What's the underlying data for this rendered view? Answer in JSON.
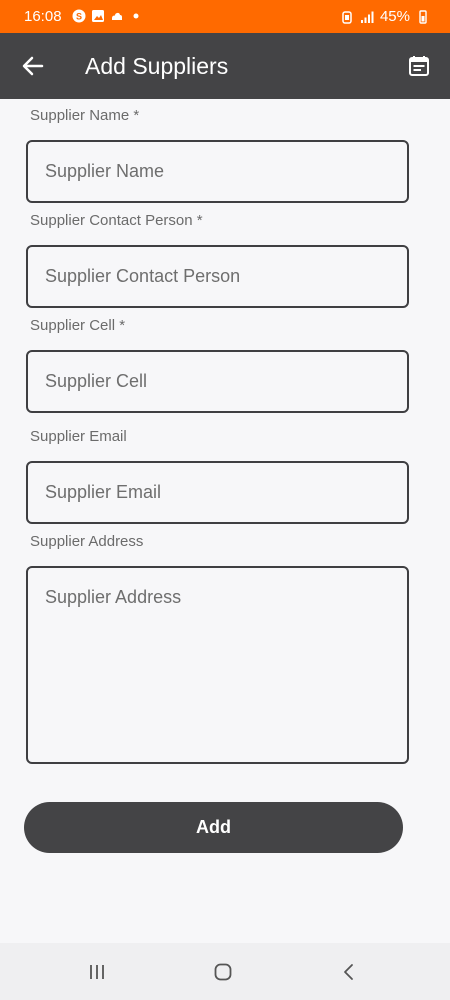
{
  "status_bar": {
    "time": "16:08",
    "battery": "45%",
    "left_icons": [
      "s-badge-icon",
      "image-icon",
      "cloud-icon",
      "dot-icon"
    ],
    "right_icons": [
      "alarm-icon",
      "signal-icon",
      "battery-icon"
    ]
  },
  "app_bar": {
    "title": "Add Suppliers",
    "back_icon": "arrow-left-icon",
    "action_icon": "calendar-icon"
  },
  "form": {
    "fields": [
      {
        "label": "Supplier Name *",
        "placeholder": "Supplier Name",
        "value": ""
      },
      {
        "label": "Supplier Contact Person *",
        "placeholder": "Supplier Contact Person",
        "value": ""
      },
      {
        "label": "Supplier Cell *",
        "placeholder": "Supplier Cell",
        "value": ""
      },
      {
        "label": "Supplier Email",
        "placeholder": "Supplier Email",
        "value": ""
      },
      {
        "label": "Supplier Address",
        "placeholder": "Supplier Address",
        "value": ""
      }
    ],
    "submit_label": "Add"
  },
  "nav_bar": {
    "icons": [
      "recent-apps-icon",
      "home-icon",
      "back-icon"
    ]
  },
  "colors": {
    "status_bar": "#ff6a00",
    "app_bar": "#444446",
    "button": "#444446",
    "background": "#f7f7f9"
  }
}
